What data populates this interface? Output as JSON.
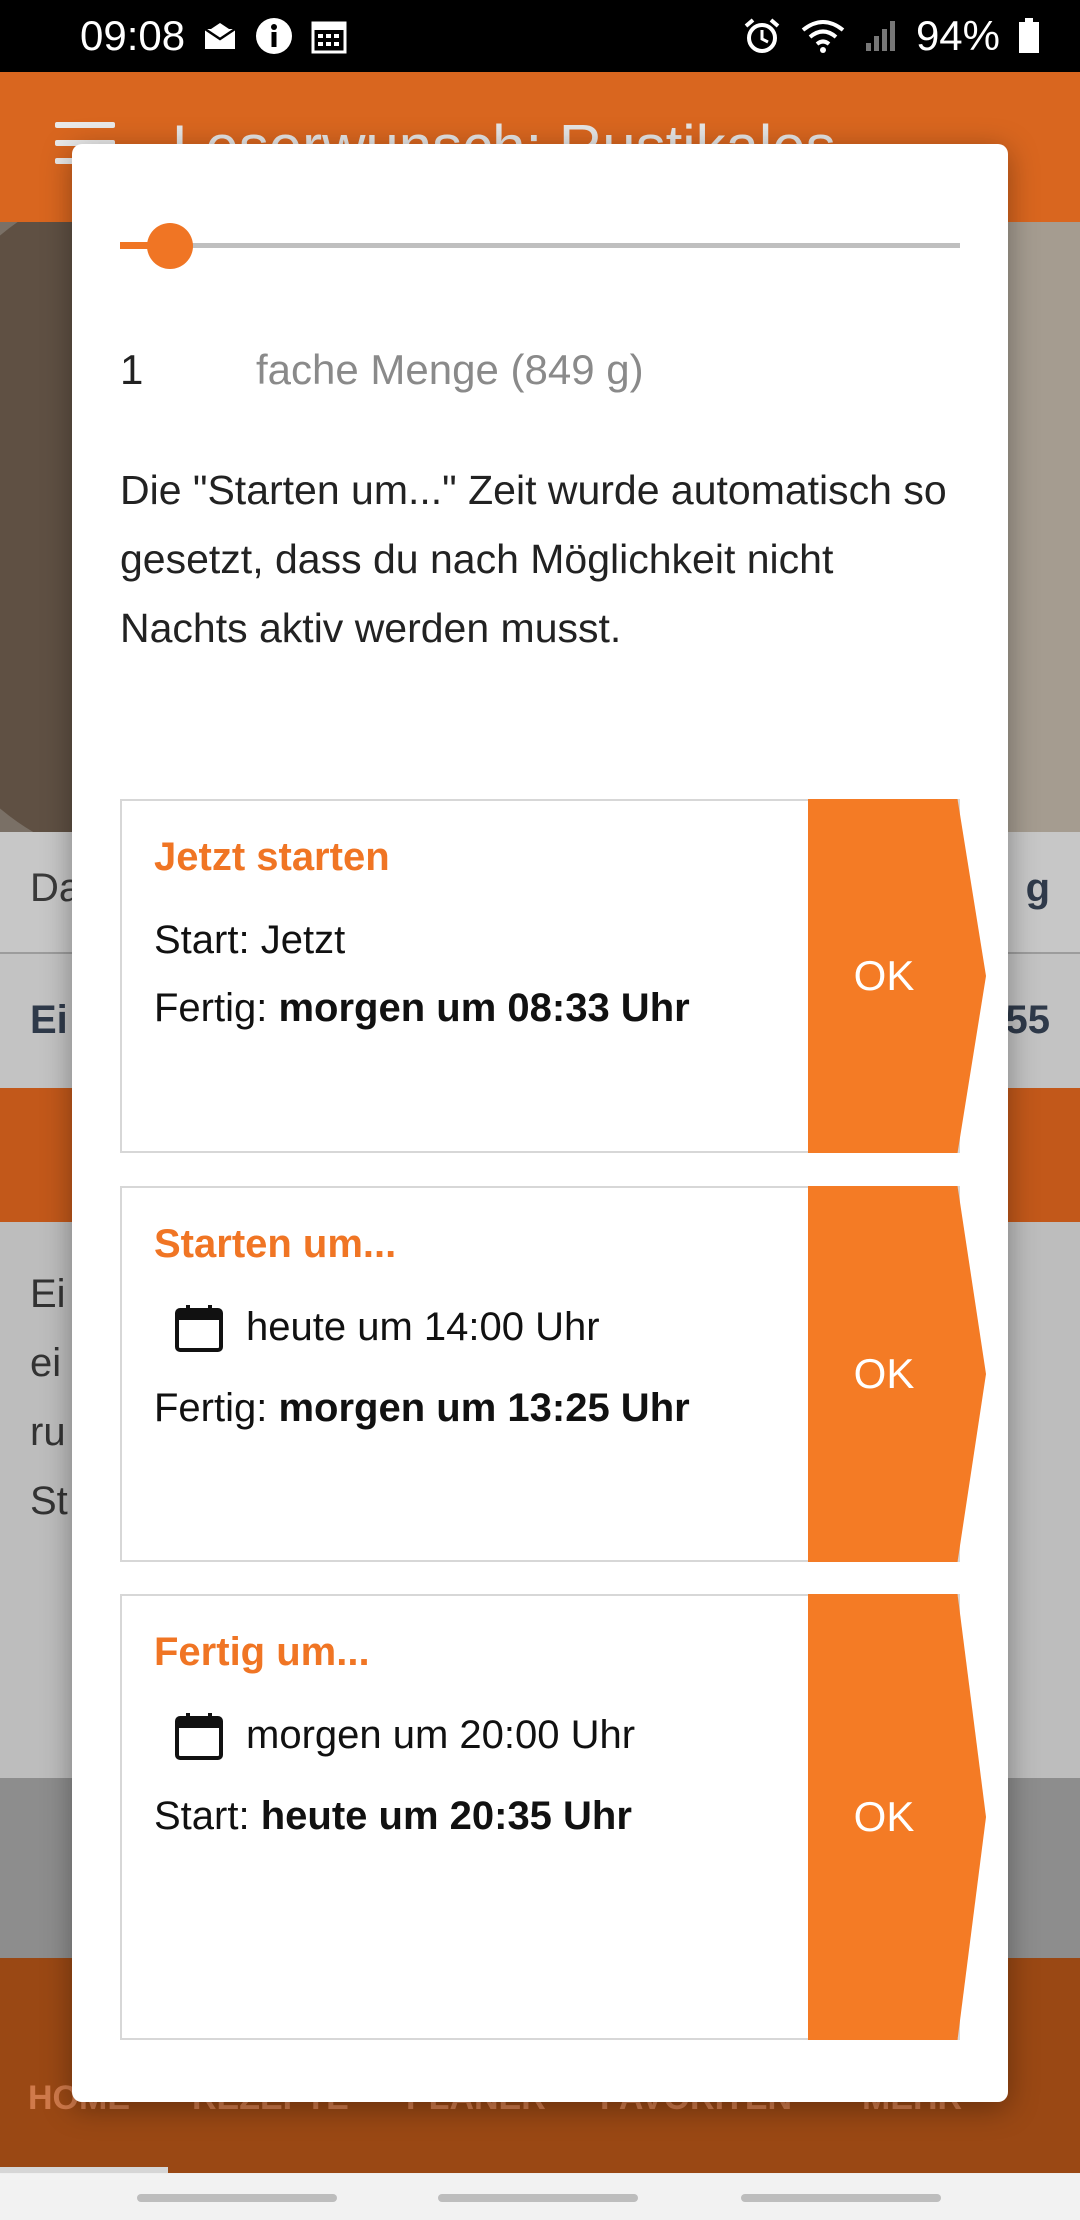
{
  "status_bar": {
    "time": "09:08",
    "battery": "94%"
  },
  "app_bar": {
    "title": "Leserwunsch: Rustikales"
  },
  "background": {
    "row1_left": "Da",
    "row1_right": "g",
    "row2_left": "Ei",
    "row2_right": "55",
    "text_lines": [
      "Ei",
      "ei",
      "ru",
      "St"
    ]
  },
  "bottom_nav": {
    "items": [
      "HOME",
      "REZEPTE",
      "PLANER",
      "FAVORITEN",
      "MEHR"
    ]
  },
  "dialog": {
    "quantity_value": "1",
    "quantity_label": "fache Menge (849 g)",
    "slider_fraction": 0.06,
    "info_text": "Die \"Starten um...\" Zeit wurde automatisch so gesetzt, dass du nach Möglichkeit nicht Nachts aktiv werden musst.",
    "cards": [
      {
        "title": "Jetzt starten",
        "start_label": "Start:",
        "start_value": "Jetzt",
        "done_label": "Fertig:",
        "done_value": "morgen um 08:33 Uhr",
        "ok": "OK"
      },
      {
        "title": "Starten um...",
        "date_value": "heute um 14:00 Uhr",
        "done_label": "Fertig:",
        "done_value": "morgen um 13:25 Uhr",
        "ok": "OK"
      },
      {
        "title": "Fertig um...",
        "date_value": "morgen um 20:00 Uhr",
        "start_label": "Start:",
        "start_value": "heute um 20:35 Uhr",
        "ok": "OK"
      }
    ]
  },
  "colors": {
    "accent": "#f47b25",
    "app_bar": "#d9661f"
  }
}
